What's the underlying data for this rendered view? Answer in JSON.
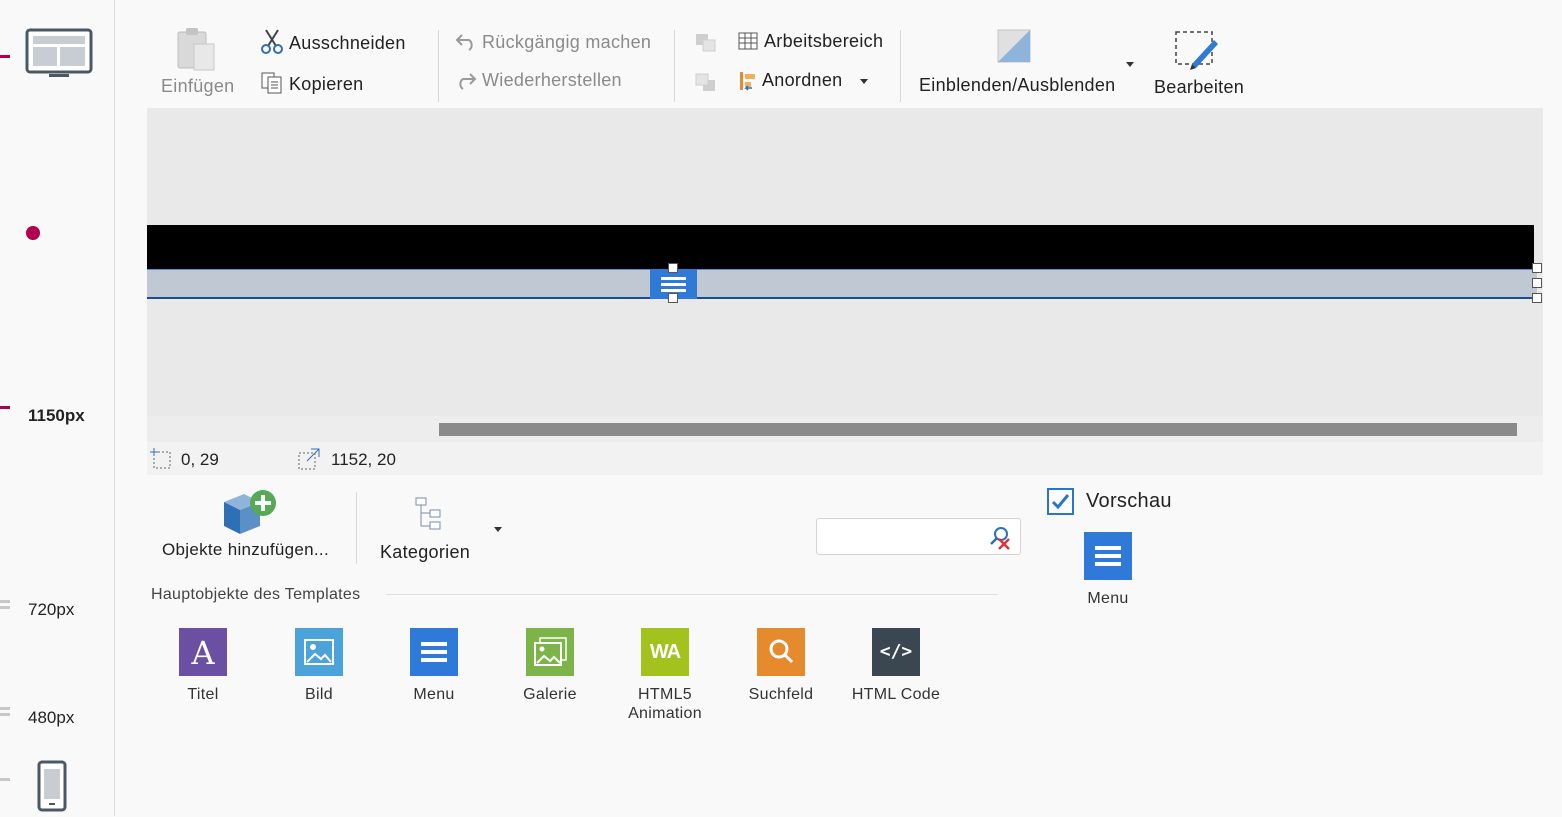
{
  "breakpoints": {
    "labels": [
      "1150px",
      "720px",
      "480px"
    ]
  },
  "toolbar": {
    "paste_label": "Einfügen",
    "cut_label": "Ausschneiden",
    "copy_label": "Kopieren",
    "undo_label": "Rückgängig machen",
    "redo_label": "Wiederherstellen",
    "workspace_label": "Arbeitsbereich",
    "arrange_label": "Anordnen",
    "show_hide_label": "Einblenden/Ausblenden",
    "edit_label": "Bearbeiten"
  },
  "status": {
    "position": "0, 29",
    "size": "1152, 20"
  },
  "panel": {
    "add_objects_label": "Objekte hinzufügen...",
    "categories_label": "Kategorien",
    "section_title": "Hauptobjekte des Templates",
    "search_placeholder": "",
    "objects": [
      {
        "label": "Titel",
        "icon": "title-icon",
        "color": "#6b4fa3"
      },
      {
        "label": "Bild",
        "icon": "image-icon",
        "color": "#4ba3d9"
      },
      {
        "label": "Menu",
        "icon": "menu-icon",
        "color": "#2f7ad8"
      },
      {
        "label": "Galerie",
        "icon": "gallery-icon",
        "color": "#7db44a"
      },
      {
        "label": "HTML5 Animation",
        "label_line1": "HTML5",
        "label_line2": "Animation",
        "icon": "html5-animation-icon",
        "color": "#a3c21d"
      },
      {
        "label": "Suchfeld",
        "icon": "search-field-icon",
        "color": "#e68a2e"
      },
      {
        "label": "HTML Code",
        "icon": "code-icon",
        "color": "#3a4650"
      }
    ]
  },
  "preview": {
    "checkbox_label": "Vorschau",
    "checked": true,
    "item_label": "Menu"
  },
  "colors": {
    "accent": "#2f7ad8",
    "breakpoint_marker": "#b0004e"
  }
}
